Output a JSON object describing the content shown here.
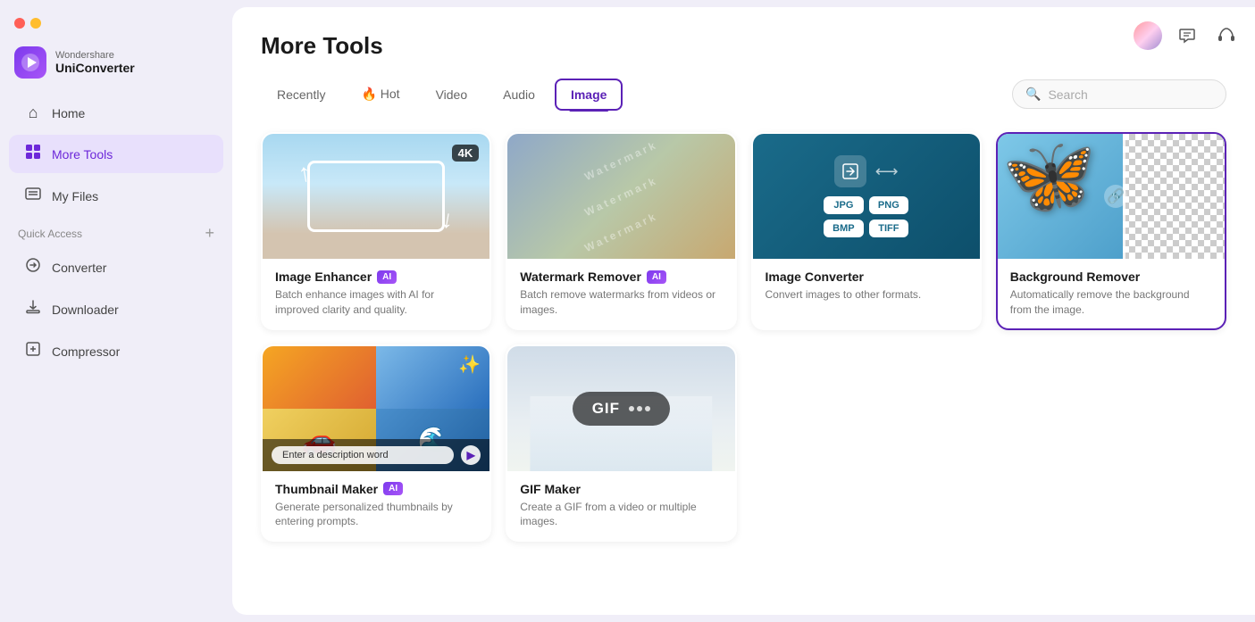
{
  "app": {
    "brand": "Wondershare",
    "title": "UniConverter",
    "logo_char": "▶"
  },
  "traffic_lights": {
    "red_label": "close",
    "yellow_label": "minimize",
    "green_label": "maximize"
  },
  "sidebar": {
    "nav_items": [
      {
        "id": "home",
        "label": "Home",
        "icon": "⌂",
        "active": false
      },
      {
        "id": "more-tools",
        "label": "More Tools",
        "icon": "⊞",
        "active": true
      },
      {
        "id": "my-files",
        "label": "My Files",
        "icon": "≡",
        "active": false
      }
    ],
    "quick_access_label": "Quick Access",
    "quick_access_add": "+",
    "quick_access_items": [
      {
        "id": "converter",
        "label": "Converter",
        "icon": "↕"
      },
      {
        "id": "downloader",
        "label": "Downloader",
        "icon": "⬇"
      },
      {
        "id": "compressor",
        "label": "Compressor",
        "icon": "⤓"
      }
    ]
  },
  "page": {
    "title": "More Tools",
    "tabs": [
      {
        "id": "recently",
        "label": "Recently",
        "active": false
      },
      {
        "id": "hot",
        "label": "🔥 Hot",
        "active": false
      },
      {
        "id": "video",
        "label": "Video",
        "active": false
      },
      {
        "id": "audio",
        "label": "Audio",
        "active": false
      },
      {
        "id": "image",
        "label": "Image",
        "active": true
      }
    ],
    "search_placeholder": "Search"
  },
  "tools": [
    {
      "id": "image-enhancer",
      "name": "Image Enhancer",
      "ai": true,
      "desc": "Batch enhance images with AI for improved clarity and quality.",
      "selected": false,
      "badge": "4K"
    },
    {
      "id": "watermark-remover",
      "name": "Watermark Remover",
      "ai": true,
      "desc": "Batch remove watermarks from videos or images.",
      "selected": false
    },
    {
      "id": "image-converter",
      "name": "Image Converter",
      "ai": false,
      "desc": "Convert images to other formats.",
      "selected": false,
      "formats": [
        "JPG",
        "PNG",
        "BMP",
        "TIFF"
      ]
    },
    {
      "id": "background-remover",
      "name": "Background Remover",
      "ai": false,
      "desc": "Automatically remove the background from the image.",
      "selected": true
    },
    {
      "id": "thumbnail-maker",
      "name": "Thumbnail Maker",
      "ai": true,
      "desc": "Generate personalized thumbnails by entering prompts.",
      "selected": false,
      "placeholder_text": "Enter a description word"
    },
    {
      "id": "gif-maker",
      "name": "GIF Maker",
      "ai": false,
      "desc": "Create a GIF from a video or multiple images.",
      "selected": false,
      "gif_label": "GIF"
    }
  ],
  "icons": {
    "search": "🔍",
    "chat": "💬",
    "headphones": "🎧",
    "ai_badge_text": "AI"
  }
}
